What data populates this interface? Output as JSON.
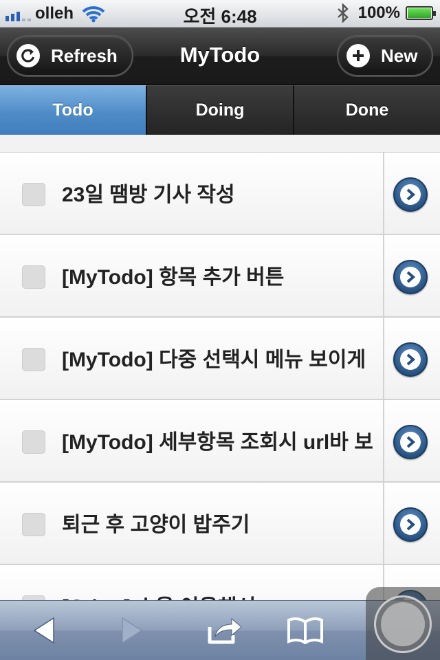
{
  "status_bar": {
    "carrier": "olleh",
    "time": "오전 6:48",
    "battery": "100%"
  },
  "nav": {
    "title": "MyTodo",
    "refresh_label": "Refresh",
    "new_label": "New"
  },
  "tabs": [
    {
      "label": "Todo",
      "active": true
    },
    {
      "label": "Doing",
      "active": false
    },
    {
      "label": "Done",
      "active": false
    }
  ],
  "items": [
    {
      "text": "23일 땜방 기사 작성"
    },
    {
      "text": "[MyTodo] 항목 추가 버튼"
    },
    {
      "text": "[MyTodo] 다중 선택시 메뉴 보이게 "
    },
    {
      "text": "[MyTodo] 세부항목 조회시 url바 보"
    },
    {
      "text": "퇴근 후 고양이 밥주기"
    },
    {
      "text": "[Other] 소울 이용해서 "
    }
  ],
  "colors": {
    "tab_active": "#4f8cc7",
    "navbar": "#1c1c1c",
    "detail_button": "#26507f"
  }
}
